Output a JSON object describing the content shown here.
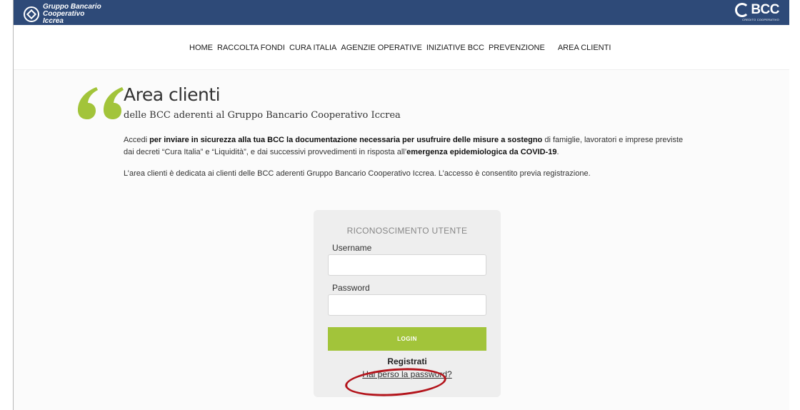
{
  "header": {
    "brand_line1": "Gruppo Bancario",
    "brand_line2": "Cooperativo Iccrea",
    "bcc_logo": "BCC",
    "bcc_subtitle": "CREDITO COOPERATIVO"
  },
  "nav": {
    "items": [
      "HOME",
      "RACCOLTA FONDI",
      "CURA ITALIA",
      "AGENZIE OPERATIVE",
      "INIZIATIVE BCC",
      "PREVENZIONE",
      "AREA CLIENTI"
    ]
  },
  "main": {
    "title": "Area clienti",
    "subtitle": "delle BCC aderenti al Gruppo Bancario Cooperativo Iccrea",
    "p1_a": "Accedi ",
    "p1_b": "per inviare in sicurezza alla tua BCC la documentazione necessaria per usufruire delle misure a sostegno",
    "p1_c": " di famiglie, lavoratori e imprese previste dai decreti “Cura Italia” e “Liquidità”, e dai successivi provvedimenti in risposta all’",
    "p1_d": "emergenza epidemiologica da COVID-19",
    "p1_e": ".",
    "p2": "L’area clienti è dedicata ai clienti delle BCC aderenti Gruppo Bancario Cooperativo Iccrea. L’accesso è consentito previa registrazione."
  },
  "login": {
    "title": "RICONOSCIMENTO UTENTE",
    "username_label": "Username",
    "username_value": "",
    "password_label": "Password",
    "password_value": "",
    "button": "LOGIN",
    "register": "Registrati",
    "forgot": "Hai perso la password?"
  },
  "colors": {
    "topbar": "#2e4a78",
    "accent_green": "#a2c43a",
    "highlight_red": "#b3141b"
  }
}
